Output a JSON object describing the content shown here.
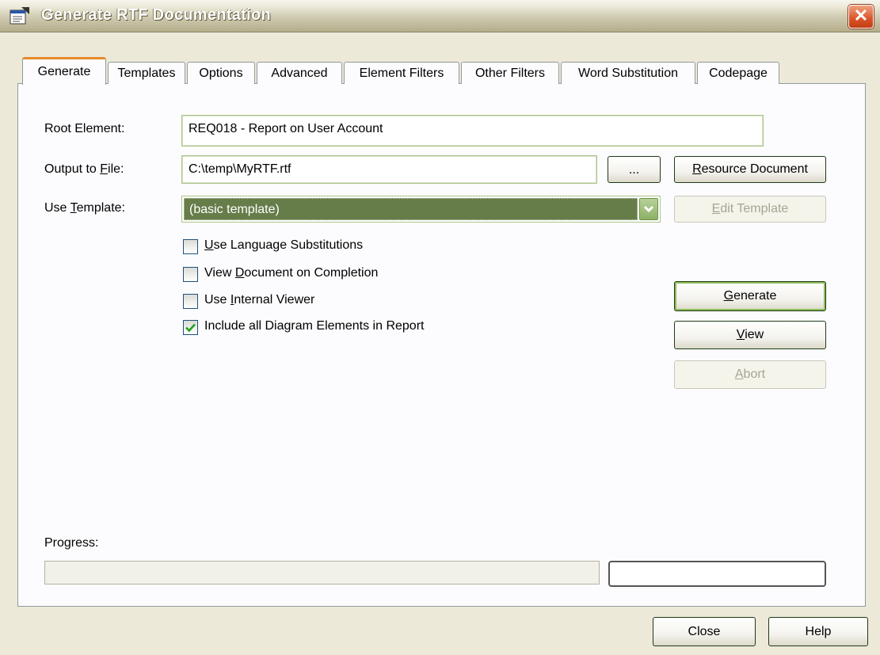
{
  "window": {
    "title": "Generate RTF Documentation",
    "close_glyph": "✕"
  },
  "tabs": [
    {
      "label": "Generate",
      "active": true
    },
    {
      "label": "Templates"
    },
    {
      "label": "Options"
    },
    {
      "label": "Advanced"
    },
    {
      "label": "Element Filters"
    },
    {
      "label": "Other Filters"
    },
    {
      "label": "Word Substitution"
    },
    {
      "label": "Codepage"
    }
  ],
  "form": {
    "root_element_label": "Root Element:",
    "root_element_value": "REQ018 - Report on User Account",
    "output_label_pre": "Output to ",
    "output_label_key": "F",
    "output_label_post": "ile:",
    "output_value": "C:\\temp\\MyRTF.rtf",
    "browse_label": "...",
    "resource_key": "R",
    "resource_rest": "esource Document",
    "template_label_pre": "Use ",
    "template_label_key": "T",
    "template_label_post": "emplate:",
    "template_value": "(basic template)",
    "edit_key": "E",
    "edit_rest": "dit Template"
  },
  "checkboxes": [
    {
      "pre": "",
      "key": "U",
      "post": "se Language Substitutions",
      "checked": false
    },
    {
      "pre": "View ",
      "key": "D",
      "post": "ocument on Completion",
      "checked": false
    },
    {
      "pre": "Use ",
      "key": "I",
      "post": "nternal Viewer",
      "checked": false
    },
    {
      "pre": "Include all Diagram Elements in Report",
      "key": "",
      "post": "",
      "checked": true
    }
  ],
  "actions": {
    "generate_key": "G",
    "generate_rest": "enerate",
    "view_key": "V",
    "view_rest": "iew",
    "abort_key": "A",
    "abort_rest": "bort"
  },
  "progress": {
    "label": "Progress:",
    "value": 0
  },
  "footer": {
    "close_label": "Close",
    "help_label": "Help"
  },
  "colors": {
    "accent_tab": "#e68b2c",
    "selection": "#667d4a",
    "check": "#21a121"
  }
}
